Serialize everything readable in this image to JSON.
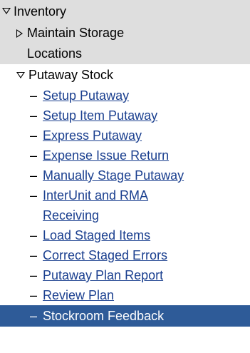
{
  "tree": {
    "root": {
      "label": "Inventory",
      "expanded": true
    },
    "maintain": {
      "label_line1": "Maintain Storage",
      "label_line2": "Locations",
      "expanded": false
    },
    "putaway": {
      "label": "Putaway Stock",
      "expanded": true
    },
    "items": [
      {
        "label": "Setup Putaway"
      },
      {
        "label": "Setup Item Putaway"
      },
      {
        "label": "Express Putaway"
      },
      {
        "label": "Expense Issue Return"
      },
      {
        "label": "Manually Stage Putaway"
      },
      {
        "label_line1": "InterUnit and RMA",
        "label_line2": "Receiving"
      },
      {
        "label": "Load Staged Items"
      },
      {
        "label": "Correct Staged Errors"
      },
      {
        "label": "Putaway Plan Report"
      },
      {
        "label": "Review Plan"
      },
      {
        "label": "Stockroom Feedback",
        "selected": true
      }
    ],
    "dash": "–"
  },
  "colors": {
    "group_background": "#dedede",
    "selected_background": "#2e5b98",
    "link": "#1a3f8f"
  }
}
